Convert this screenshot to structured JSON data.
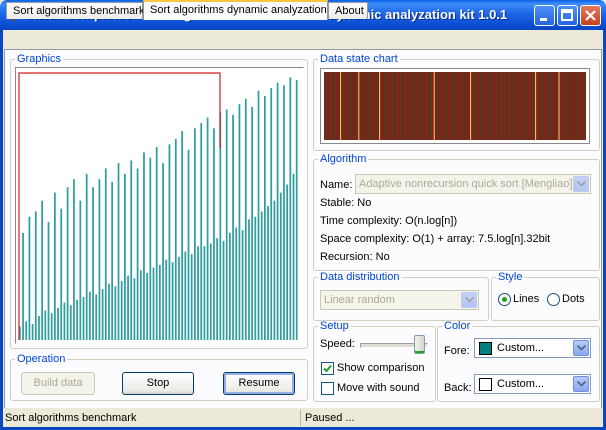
{
  "window": {
    "title": "Inside comparison sort algorithms benchmark & dynamic analyzation kit 1.0.1"
  },
  "tabs": [
    {
      "label": "Sort algorithms benchmark"
    },
    {
      "label": "Sort algorithms dynamic analyzation"
    },
    {
      "label": "About"
    }
  ],
  "graphics": {
    "legend": "Graphics",
    "bar_color": "#2E9E9E",
    "highlight_color": "#D02020",
    "bar_values": [
      5,
      40,
      7,
      46,
      6,
      48,
      9,
      52,
      11,
      44,
      10,
      55,
      12,
      49,
      14,
      57,
      13,
      60,
      15,
      52,
      16,
      62,
      18,
      57,
      17,
      60,
      19,
      64,
      21,
      59,
      20,
      66,
      22,
      62,
      24,
      67,
      23,
      64,
      26,
      70,
      25,
      68,
      27,
      72,
      28,
      66,
      30,
      73,
      29,
      75,
      31,
      78,
      33,
      71,
      32,
      79,
      35,
      81,
      35,
      83,
      36,
      79,
      38,
      85,
      37,
      86,
      40,
      84,
      42,
      88,
      41,
      90,
      45,
      87,
      46,
      93,
      48,
      91,
      50,
      94,
      52,
      96,
      55,
      95,
      58,
      98,
      62,
      97
    ]
  },
  "operation": {
    "legend": "Operation",
    "build_label": "Build data",
    "stop_label": "Stop",
    "resume_label": "Resume"
  },
  "data_state_chart": {
    "legend": "Data state chart",
    "background": "#8B1A1A",
    "line_color": "#1E5A1E",
    "accent_color": "#E8E060"
  },
  "algorithm": {
    "legend": "Algorithm",
    "name_label": "Name:",
    "name_value": "Adaptive nonrecursion quick sort [Mengliao]",
    "stable": "Stable: No",
    "time_complexity": "Time complexity: O(n.log[n])",
    "space_complexity": "Space complexity: O(1) + array: 7.5.log[n].32bit",
    "recursion": "Recursion: No"
  },
  "data_distribution": {
    "legend": "Data distribution",
    "value": "Linear random"
  },
  "style": {
    "legend": "Style",
    "lines_label": "Lines",
    "dots_label": "Dots",
    "selected": "Lines"
  },
  "setup": {
    "legend": "Setup",
    "speed_label": "Speed:",
    "speed_level": 1.0,
    "show_comparison_label": "Show comparison",
    "show_comparison_checked": true,
    "move_with_sound_label": "Move with sound",
    "move_with_sound_checked": false
  },
  "color": {
    "legend": "Color",
    "fore_label": "Fore:",
    "fore_value": "Custom...",
    "fore_color": "#008080",
    "back_label": "Back:",
    "back_value": "Custom...",
    "back_color": "#FFFFFF"
  },
  "statusbar": {
    "left": "Sort algorithms benchmark",
    "right": "Paused ..."
  }
}
